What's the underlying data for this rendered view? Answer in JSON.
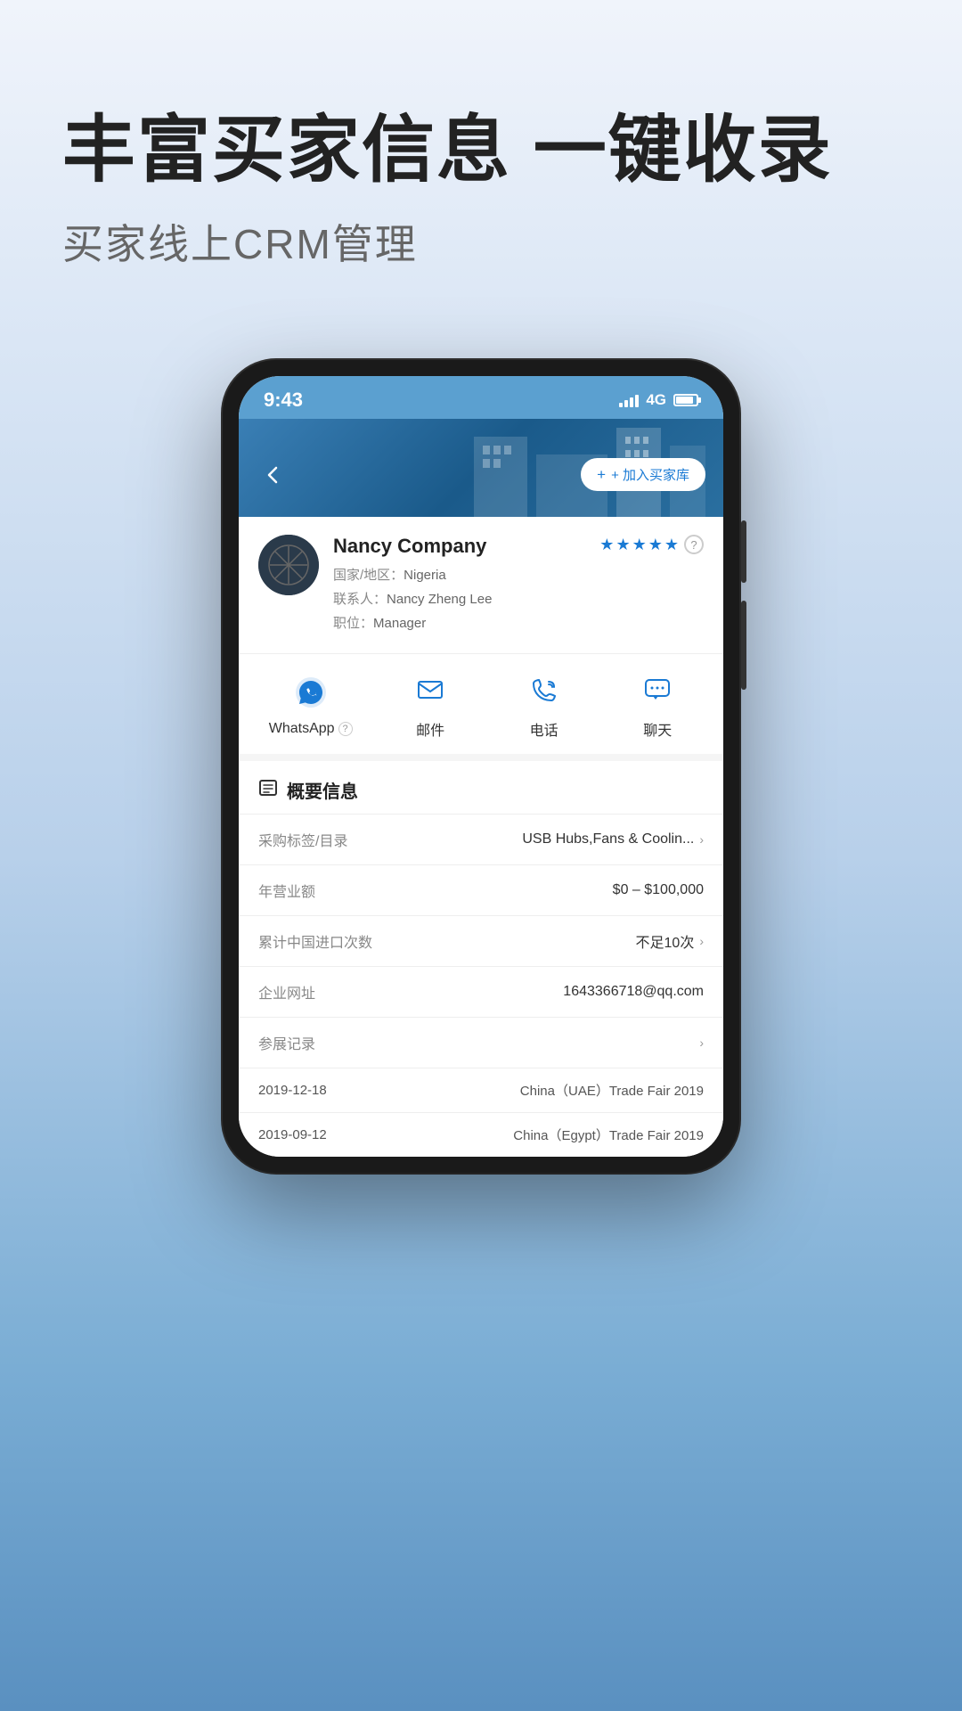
{
  "header": {
    "main_title": "丰富买家信息 一键收录",
    "sub_title": "买家线上CRM管理"
  },
  "phone": {
    "status_bar": {
      "time": "9:43",
      "signal": "4G"
    },
    "nav": {
      "back_icon": "‹",
      "action_button": "+ 加入买家库"
    },
    "company_card": {
      "name": "Nancy Company",
      "country_label": "国家/地区：",
      "country": "Nigeria",
      "contact_label": "联系人：",
      "contact": "Nancy Zheng Lee",
      "position_label": "职位：",
      "position": "Manager",
      "stars": [
        "★",
        "★",
        "★",
        "★",
        "★"
      ],
      "half_star": "☆"
    },
    "action_buttons": [
      {
        "id": "whatsapp",
        "label": "WhatsApp",
        "has_help": true
      },
      {
        "id": "email",
        "label": "邮件",
        "has_help": false
      },
      {
        "id": "phone",
        "label": "电话",
        "has_help": false
      },
      {
        "id": "chat",
        "label": "聊天",
        "has_help": false
      }
    ],
    "overview": {
      "title": "概要信息",
      "rows": [
        {
          "label": "采购标签/目录",
          "value": "USB Hubs,Fans & Coolin...",
          "has_arrow": true
        },
        {
          "label": "年营业额",
          "value": "$0 – $100,000",
          "has_arrow": false
        },
        {
          "label": "累计中国进口次数",
          "value": "不足10次",
          "has_arrow": true
        },
        {
          "label": "企业网址",
          "value": "1643366718@qq.com",
          "has_arrow": false
        },
        {
          "label": "参展记录",
          "value": "",
          "has_arrow": true
        }
      ],
      "trade_records": [
        {
          "date": "2019-12-18",
          "event": "China（UAE）Trade Fair 2019"
        },
        {
          "date": "2019-09-12",
          "event": "China（Egypt）Trade Fair 2019"
        }
      ]
    }
  },
  "colors": {
    "blue_primary": "#1a7ad4",
    "blue_light": "#5ba0d0",
    "star_color": "#1a7ad4",
    "text_dark": "#222",
    "text_gray": "#888",
    "border": "#eee"
  }
}
